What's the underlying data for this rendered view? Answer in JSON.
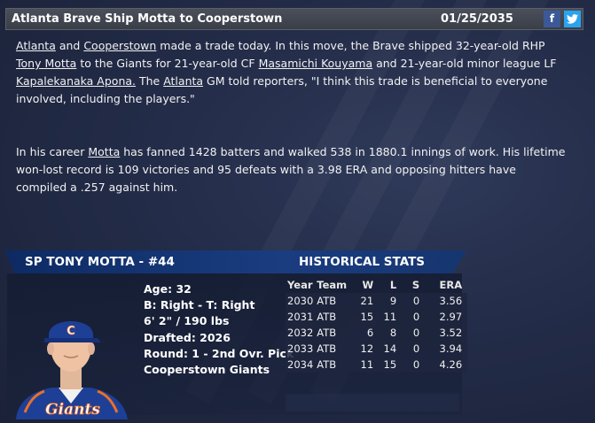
{
  "header": {
    "headline": "Atlanta Brave Ship Motta to Cooperstown",
    "date": "01/25/2035",
    "facebook_label": "f",
    "twitter_label": "🐦"
  },
  "article": {
    "p1": [
      {
        "text": "Atlanta",
        "link": true
      },
      {
        "text": " and ",
        "link": false
      },
      {
        "text": "Cooperstown",
        "link": true
      },
      {
        "text": " made a trade today. In this move, the Brave shipped 32-year-old RHP ",
        "link": false
      },
      {
        "text": "Tony Motta",
        "link": true
      },
      {
        "text": " to the Giants for 21-year-old CF ",
        "link": false
      },
      {
        "text": "Masamichi Kouyama",
        "link": true
      },
      {
        "text": " and 21-year-old  minor league LF ",
        "link": false
      },
      {
        "text": "Kapalekanaka Apona.",
        "link": true
      },
      {
        "text": " The ",
        "link": false
      },
      {
        "text": "Atlanta",
        "link": true
      },
      {
        "text": " GM told reporters, \"I think this trade is beneficial to everyone involved, including the players.\"",
        "link": false
      }
    ],
    "p2": [
      {
        "text": "In his career ",
        "link": false
      },
      {
        "text": "Motta",
        "link": true
      },
      {
        "text": " has fanned 1428 batters and walked 538 in 1880.1 innings of work. His lifetime won-lost record is 109 victories and 95 defeats with a 3.98 ERA and opposing hitters have compiled a .257 against him.",
        "link": false
      }
    ]
  },
  "player": {
    "title": "SP TONY MOTTA - #44",
    "bio": [
      "Age: 32",
      "B: Right - T: Right",
      "6' 2\" / 190 lbs",
      "Drafted: 2026",
      "Round: 1 - 2nd Ovr. Pick",
      "Cooperstown Giants"
    ],
    "jersey_text": "Giants",
    "cap_letter": "C"
  },
  "stats": {
    "title": "HISTORICAL STATS",
    "columns": [
      "Year",
      "Team",
      "W",
      "L",
      "S",
      "ERA"
    ],
    "rows": [
      [
        "2030",
        "ATB",
        "21",
        "9",
        "0",
        "3.56"
      ],
      [
        "2031",
        "ATB",
        "15",
        "11",
        "0",
        "2.97"
      ],
      [
        "2032",
        "ATB",
        "6",
        "8",
        "0",
        "3.52"
      ],
      [
        "2033",
        "ATB",
        "12",
        "14",
        "0",
        "3.94"
      ],
      [
        "2034",
        "ATB",
        "11",
        "15",
        "0",
        "4.26"
      ]
    ]
  },
  "colors": {
    "header_band": "#0d2a63",
    "facebook": "#3b5998",
    "twitter": "#2aa3ef",
    "jersey": "#1e3f96",
    "cap_accent": "#e8702a"
  }
}
